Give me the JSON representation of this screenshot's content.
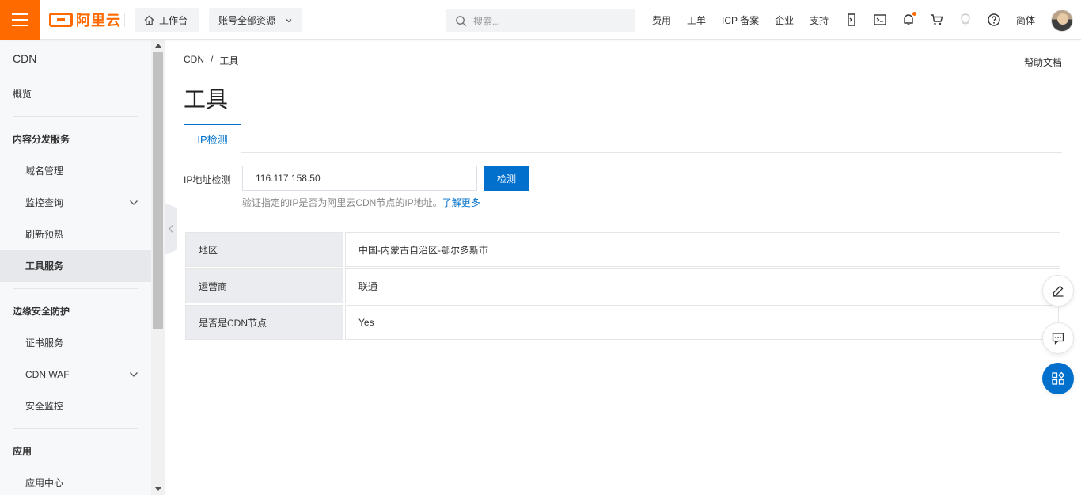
{
  "header": {
    "logo_text": "阿里云",
    "workbench_label": "工作台",
    "resources_label": "账号全部资源",
    "search_placeholder": "搜索...",
    "links": [
      "费用",
      "工单",
      "ICP 备案",
      "企业",
      "支持"
    ],
    "language": "简体",
    "accent_color": "#ff6a00"
  },
  "sidebar": {
    "title": "CDN",
    "overview": "概览",
    "groups": [
      {
        "label": "内容分发服务",
        "items": [
          "域名管理",
          "监控查询",
          "刷新预热",
          "工具服务"
        ]
      },
      {
        "label": "边缘安全防护",
        "items": [
          "证书服务",
          "CDN WAF",
          "安全监控"
        ]
      },
      {
        "label": "应用",
        "items": [
          "应用中心"
        ]
      }
    ],
    "active_item": "工具服务"
  },
  "main": {
    "breadcrumb": [
      "CDN",
      "/",
      "工具"
    ],
    "help_doc": "帮助文档",
    "title": "工具",
    "tab_label": "IP检测",
    "ip_label": "IP地址检测",
    "ip_value": "116.117.158.50",
    "detect_button": "检测",
    "hint_text": "验证指定的IP是否为阿里云CDN节点的IP地址。",
    "hint_link": "了解更多",
    "results": [
      {
        "key": "地区",
        "value": "中国-内蒙古自治区-鄂尔多斯市"
      },
      {
        "key": "运营商",
        "value": "联通"
      },
      {
        "key": "是否是CDN节点",
        "value": "Yes"
      }
    ],
    "primary_color": "#0070cc"
  }
}
